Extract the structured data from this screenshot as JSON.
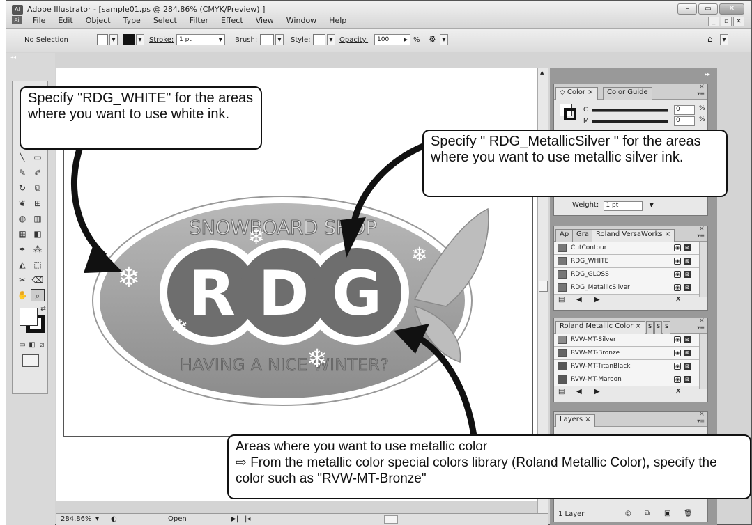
{
  "window": {
    "app_icon": "Ai",
    "title": "Adobe Illustrator - [sample01.ps @ 284.86% (CMYK/Preview) ]",
    "controls": [
      "minimize",
      "maximize",
      "close"
    ]
  },
  "menu": [
    "File",
    "Edit",
    "Object",
    "Type",
    "Select",
    "Filter",
    "Effect",
    "View",
    "Window",
    "Help"
  ],
  "control_bar": {
    "selection": "No Selection",
    "stroke_label": "Stroke:",
    "stroke_value": "1 pt",
    "brush_label": "Brush:",
    "style_label": "Style:",
    "opacity_label": "Opacity:",
    "opacity_value": "100",
    "percent": "%"
  },
  "status_bar": {
    "zoom": "284.86%",
    "status": "Open"
  },
  "panels": {
    "color": {
      "tabs": [
        "Color",
        "Color Guide"
      ],
      "c_label": "C",
      "c_value": "0",
      "m_label": "M",
      "m_value": "0",
      "percent": "%"
    },
    "stroke": {
      "weight_label": "Weight:",
      "weight_value": "1 pt"
    },
    "versaworks": {
      "tabs": [
        "Ap",
        "Gra",
        "Roland VersaWorks"
      ],
      "items": [
        "CutContour",
        "RDG_WHITE",
        "RDG_GLOSS",
        "RDG_MetallicSilver"
      ]
    },
    "metallic": {
      "tabs": [
        "Roland Metallic Color",
        "s",
        "s",
        "s"
      ],
      "items": [
        "RVW-MT-Silver",
        "RVW-MT-Bronze",
        "RVW-MT-TitanBlack",
        "RVW-MT-Maroon"
      ]
    },
    "layers": {
      "tab": "Layers",
      "count": "1 Layer"
    }
  },
  "artwork": {
    "top_text": "SNOWBOARD SHOP",
    "letters": [
      "R",
      "D",
      "G"
    ],
    "bottom_text": "HAVING A NICE WINTER?"
  },
  "callouts": {
    "white": "Specify \"RDG_WHITE\" for the areas where you want to use white ink.",
    "silver": "Specify \" RDG_MetallicSilver \" for the areas where you want to use metallic silver ink.",
    "metallic_line1": "Areas where you want to use metallic color",
    "metallic_line2": "⇨ From the metallic color special colors library (Roland Metallic Color), specify the color such as \"RVW-MT-Bronze\""
  },
  "colors": {
    "panel_bg": "#e8e8e8",
    "dock_bg": "#999999",
    "logo_dark": "#6e6e6e",
    "logo_mid": "#a6a6a6"
  }
}
